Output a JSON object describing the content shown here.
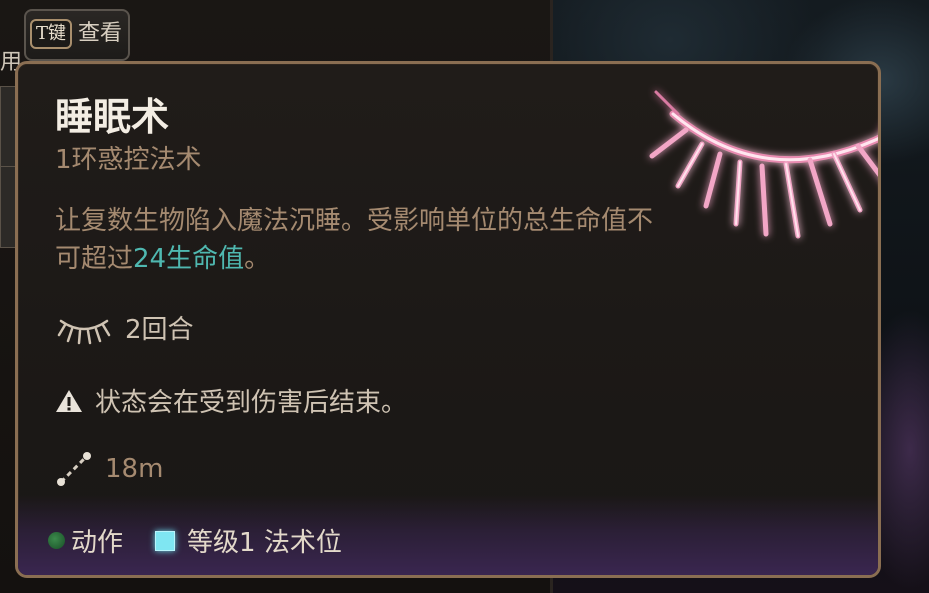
{
  "background": {
    "side_glyph": "用"
  },
  "key_hint": {
    "key": "T键",
    "label": "查看"
  },
  "spell": {
    "name": "睡眠术",
    "subtitle": "1环惑控法术",
    "description_before": "让复数生物陷入魔法沉睡。受影响单位的总生命值不可超过",
    "description_highlight": "24生命值",
    "description_after": "。",
    "icon": "closed-eye-lashes-icon",
    "duration_icon": "eyelash-icon",
    "duration": "2回合",
    "warning_icon": "warning-icon",
    "warning": "状态会在受到伤害后结束。",
    "range_icon": "range-icon",
    "range": "18m"
  },
  "footer": {
    "action_label": "动作",
    "spell_slot_label": "等级1 法术位"
  },
  "colors": {
    "accent_teal": "#4fb8b0",
    "subtitle_tan": "#a58a70",
    "border_bronze": "#8a6e52",
    "action_green": "#2f7a3e",
    "slot_cyan": "#7fe6f2",
    "icon_pink": "#f0a8c4"
  }
}
